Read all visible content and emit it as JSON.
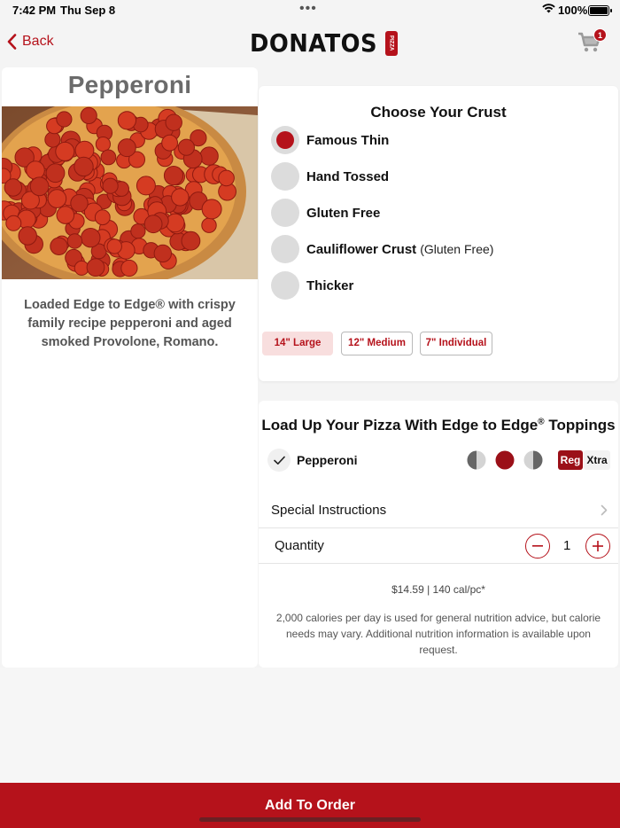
{
  "status_bar": {
    "time": "7:42 PM",
    "date": "Thu Sep 8",
    "battery": "100%"
  },
  "nav": {
    "back_label": "Back",
    "logo_text": "DONATOS",
    "logo_badge": "PIZZA",
    "cart_count": "1"
  },
  "product": {
    "title": "Pepperoni",
    "description": "Loaded Edge to Edge® with crispy family recipe pepperoni and aged smoked Provolone, Romano."
  },
  "crust": {
    "title": "Choose Your Crust",
    "options": [
      {
        "label": "Famous Thin",
        "sub": "",
        "selected": true
      },
      {
        "label": "Hand Tossed",
        "sub": "",
        "selected": false
      },
      {
        "label": "Gluten Free",
        "sub": "",
        "selected": false
      },
      {
        "label": "Cauliflower Crust",
        "sub": "(Gluten Free)",
        "selected": false
      },
      {
        "label": "Thicker",
        "sub": "",
        "selected": false
      }
    ],
    "sizes": [
      {
        "label": "14\" Large",
        "active": true
      },
      {
        "label": "12\" Medium",
        "active": false
      },
      {
        "label": "7\" Individual",
        "active": false
      }
    ]
  },
  "toppings": {
    "title": "Load Up Your Pizza With Edge to Edge",
    "title_mark": "®",
    "title_suffix": " Toppings",
    "items": [
      {
        "name": "Pepperoni",
        "checked": true,
        "coverage": "whole",
        "amount": "Reg"
      }
    ],
    "reg_label": "Reg",
    "xtra_label": "Xtra"
  },
  "special_instructions": {
    "label": "Special Instructions"
  },
  "quantity": {
    "label": "Quantity",
    "value": "1"
  },
  "pricing": {
    "price_line": "$14.59 | 140 cal/pc*",
    "note": "2,000 calories per day is used for general nutrition advice, but calorie needs may vary. Additional nutrition information is available upon request."
  },
  "footer": {
    "add_label": "Add To Order"
  },
  "colors": {
    "brand": "#b5121b",
    "brand_dark": "#9b1018",
    "background": "#f4f4f4",
    "card": "#ffffff"
  }
}
